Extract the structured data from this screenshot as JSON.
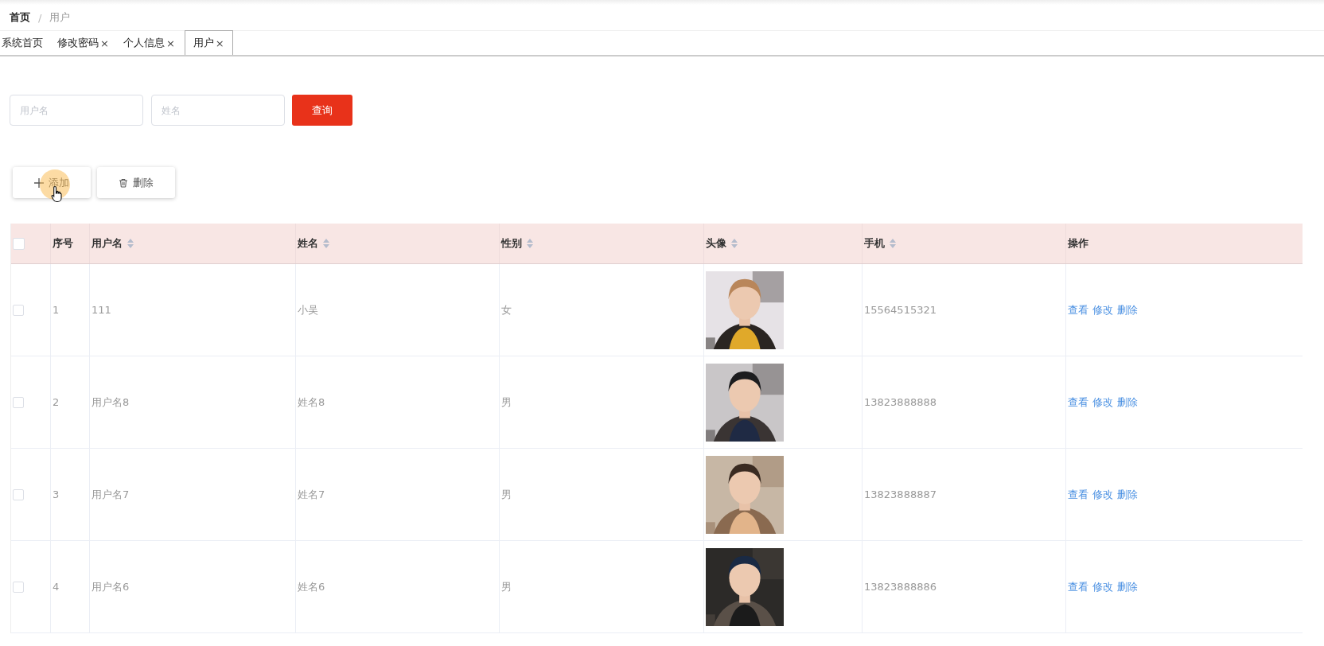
{
  "breadcrumb": [
    {
      "label": "首页",
      "current": false
    },
    {
      "label": "/",
      "kind": "separator"
    },
    {
      "label": "用户",
      "current": true
    }
  ],
  "tabs": [
    {
      "label": "系统首页",
      "selected": false,
      "closable": false
    },
    {
      "label": "修改密码",
      "selected": false,
      "closable": true,
      "close": "×"
    },
    {
      "label": "个人信息",
      "selected": false,
      "closable": true,
      "close": "×"
    },
    {
      "label": "用户",
      "selected": true,
      "closable": true,
      "close": "×"
    }
  ],
  "search": {
    "fields": [
      {
        "placeholder": "用户名"
      },
      {
        "placeholder": "姓名"
      }
    ],
    "button": "查询"
  },
  "actions": [
    {
      "label": "添加",
      "kind": "add"
    },
    {
      "label": "删除",
      "kind": "delete"
    }
  ],
  "table": {
    "all_checked": false,
    "columns": [
      {
        "label": "序号",
        "sortable": false
      },
      {
        "label": "用户名",
        "sortable": true
      },
      {
        "label": "姓名",
        "sortable": true
      },
      {
        "label": "性别",
        "sortable": true
      },
      {
        "label": "头像",
        "sortable": true
      },
      {
        "label": "手机",
        "sortable": true
      },
      {
        "label": "操作",
        "sortable": false
      }
    ],
    "rows": [
      {
        "checked": false,
        "index": "1",
        "username": "111",
        "name": "小吴",
        "gender": "女",
        "avatar": {
          "kind": "picture"
        },
        "phone": "15564515321",
        "ops": [
          "查看",
          "修改",
          "删除"
        ]
      },
      {
        "checked": false,
        "index": "2",
        "username": "用户名8",
        "name": "姓名8",
        "gender": "男",
        "avatar": {
          "kind": "picture"
        },
        "phone": "13823888888",
        "ops": [
          "查看",
          "修改",
          "删除"
        ]
      },
      {
        "checked": false,
        "index": "3",
        "username": "用户名7",
        "name": "姓名7",
        "gender": "男",
        "avatar": {
          "kind": "picture"
        },
        "phone": "13823888887",
        "ops": [
          "查看",
          "修改",
          "删除"
        ]
      },
      {
        "checked": false,
        "index": "4",
        "username": "用户名6",
        "name": "姓名6",
        "gender": "男",
        "avatar": {
          "kind": "picture"
        },
        "phone": "13823888886",
        "ops": [
          "查看",
          "修改",
          "删除"
        ]
      }
    ]
  },
  "click_indicator": {
    "on": true
  }
}
